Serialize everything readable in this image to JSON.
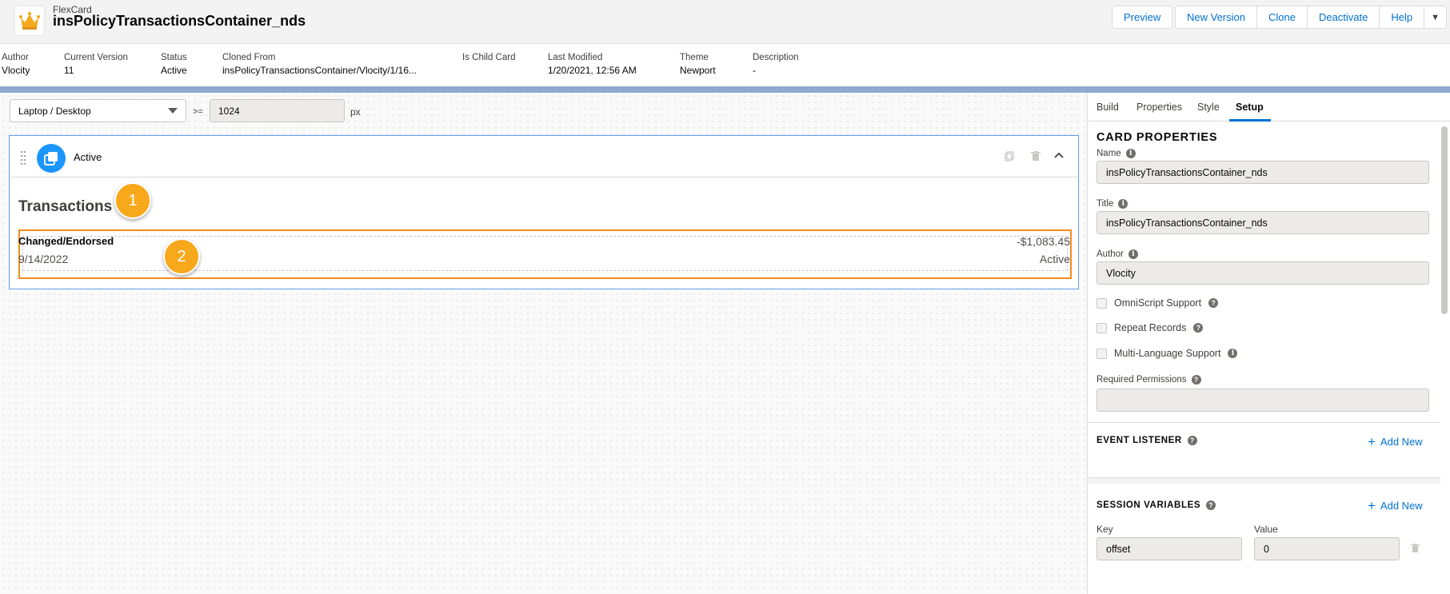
{
  "header": {
    "type_label": "FlexCard",
    "title": "insPolicyTransactionsContainer_nds",
    "logo_icon": "crown-icon",
    "buttons": [
      "Preview",
      "New Version",
      "Clone",
      "Deactivate",
      "Help"
    ]
  },
  "meta": [
    {
      "label": "Author",
      "value": "Vlocity"
    },
    {
      "label": "Current Version",
      "value": "11"
    },
    {
      "label": "Status",
      "value": "Active"
    },
    {
      "label": "Cloned From",
      "value": "insPolicyTransactionsContainer/Vlocity/1/16..."
    },
    {
      "label": "Is Child Card",
      "value": ""
    },
    {
      "label": "Last Modified",
      "value": "1/20/2021, 12:56 AM"
    },
    {
      "label": "Theme",
      "value": "Newport"
    },
    {
      "label": "Description",
      "value": "-"
    }
  ],
  "canvas": {
    "device": "Laptop / Desktop",
    "gte": ">=",
    "width": "1024",
    "unit": "px",
    "state": {
      "name": "Active",
      "icon": "state-stack-icon",
      "section_title": "Transactions",
      "record": {
        "title": "Changed/Endorsed",
        "date": "9/14/2022",
        "amount": "-$1,083.45",
        "status": "Active"
      }
    },
    "callouts": [
      "1",
      "2"
    ]
  },
  "panel": {
    "tabs": [
      "Build",
      "Properties",
      "Style",
      "Setup"
    ],
    "active_tab": "Setup",
    "heading": "CARD PROPERTIES",
    "name_label": "Name",
    "name_value": "insPolicyTransactionsContainer_nds",
    "title_label": "Title",
    "title_value": "insPolicyTransactionsContainer_nds",
    "author_label": "Author",
    "author_value": "Vlocity",
    "checkboxes": [
      {
        "label": "OmniScript Support",
        "checked": false
      },
      {
        "label": "Repeat Records",
        "checked": false
      },
      {
        "label": "Multi-Language Support",
        "checked": false
      }
    ],
    "permissions_label": "Required Permissions",
    "permissions_value": "",
    "event_listener_label": "EVENT LISTENER",
    "session_variables_label": "SESSION VARIABLES",
    "add_new": "Add New",
    "key_label": "Key",
    "value_label": "Value",
    "session_key": "offset",
    "session_value": "0"
  },
  "colors": {
    "accent": "#0070d2",
    "highlight": "#f28c1a",
    "callout": "#f7a81b",
    "state_icon": "#1b96ff",
    "logo": "#f4a81d"
  }
}
